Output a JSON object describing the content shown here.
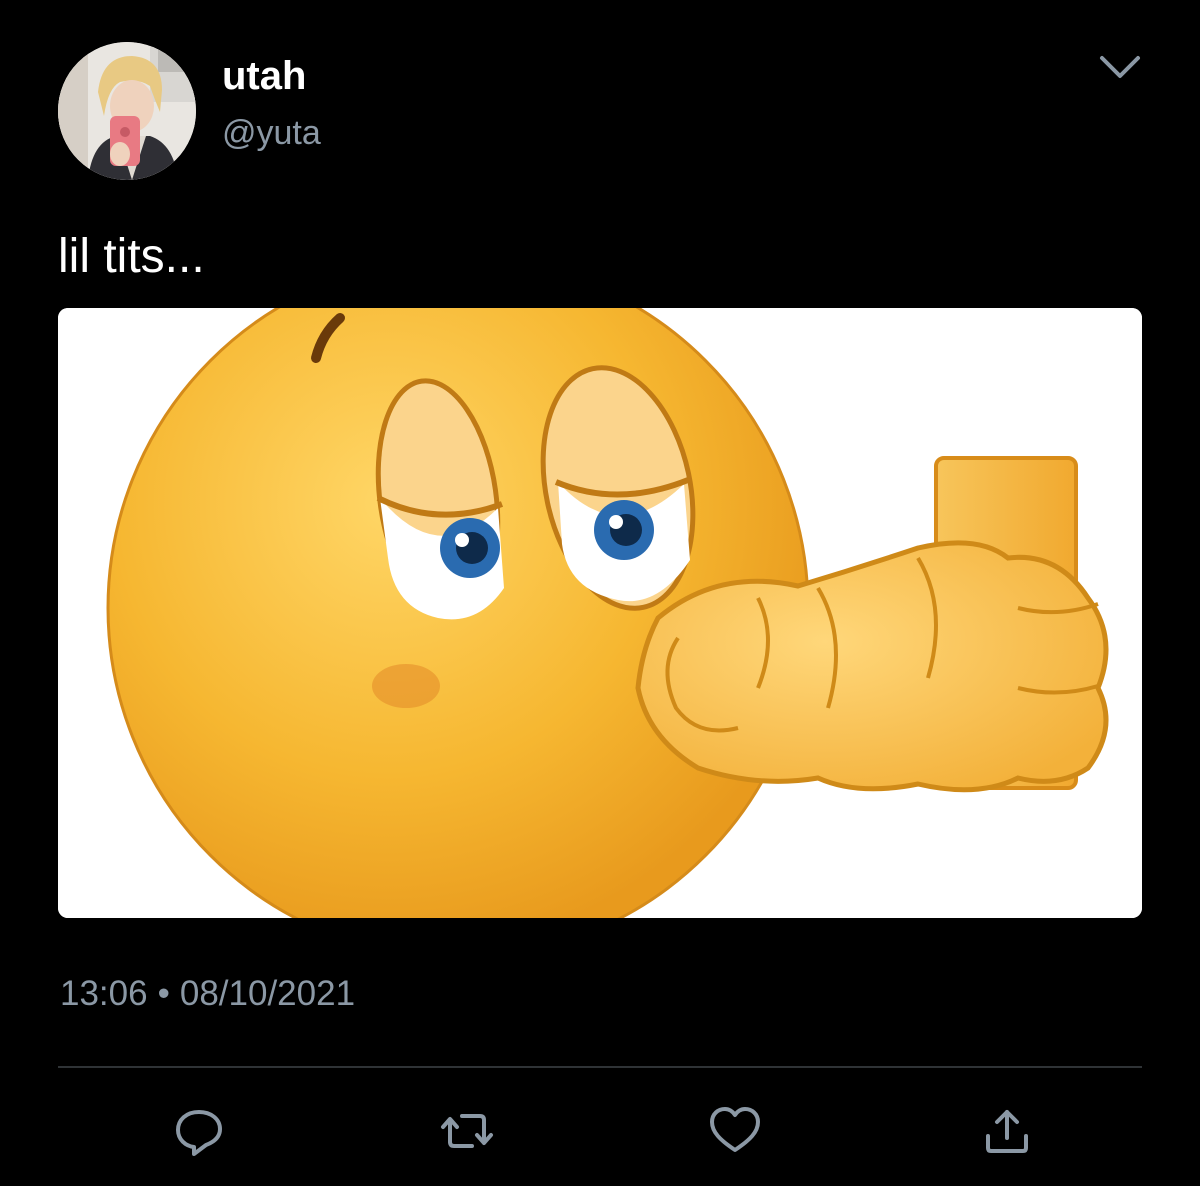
{
  "tweet": {
    "display_name": "utah",
    "handle": "@yuta",
    "text": "lil tits...",
    "time": "13:06",
    "separator": "•",
    "date": "08/10/2021"
  },
  "icons": {
    "menu": "chevron-down-icon",
    "reply": "reply-icon",
    "retweet": "retweet-icon",
    "like": "heart-icon",
    "share": "share-icon"
  },
  "colors": {
    "background": "#000000",
    "primary_text": "#ffffff",
    "secondary_text": "#8b98a5",
    "icon": "#8b98a5",
    "divider": "#2f3336",
    "emoji_yellow": "#f5b52e"
  }
}
